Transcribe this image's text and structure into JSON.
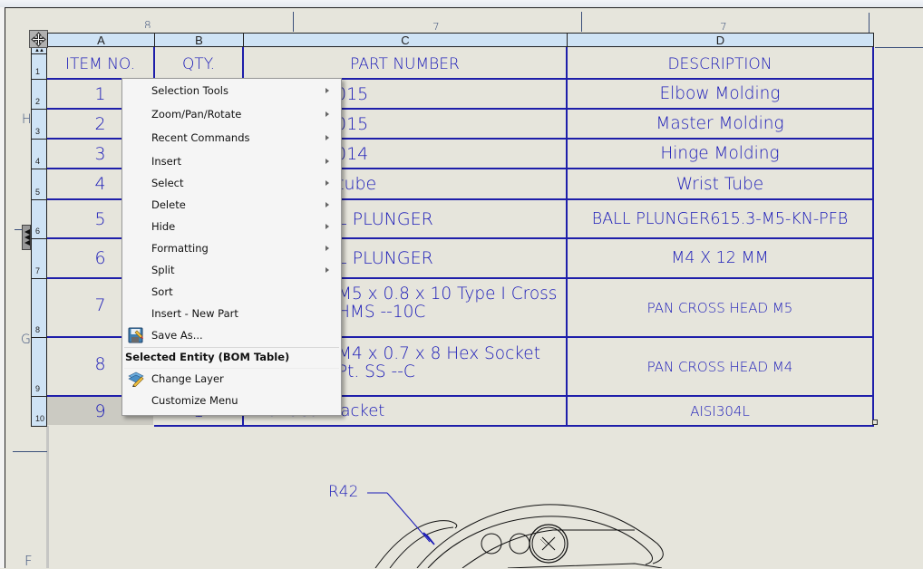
{
  "drawing": {
    "zone_labels": {
      "top": [
        "8",
        "7",
        "7"
      ],
      "left": [
        "H",
        "G",
        "F"
      ]
    },
    "dimension_label": "R42"
  },
  "bom_table": {
    "column_letters": [
      "A",
      "B",
      "C",
      "D"
    ],
    "row_numbers": [
      "1",
      "2",
      "3",
      "4",
      "5",
      "6",
      "7",
      "8",
      "9",
      "10"
    ],
    "headers": {
      "item_no": "ITEM NO.",
      "qty": "QTY.",
      "part_number": "PART NUMBER",
      "description": "DESCRIPTION"
    },
    "rows": [
      {
        "item": "1",
        "qty": "",
        "part": "015",
        "description": "Elbow Molding"
      },
      {
        "item": "2",
        "qty": "",
        "part": "015",
        "description": "Master Molding"
      },
      {
        "item": "3",
        "qty": "",
        "part": "014",
        "description": "Hinge Molding"
      },
      {
        "item": "4",
        "qty": "",
        "part": "tube",
        "description": "Wrist Tube"
      },
      {
        "item": "5",
        "qty": "",
        "part": "L PLUNGER",
        "description": "BALL PLUNGER615.3-M5-KN-PFB"
      },
      {
        "item": "6",
        "qty": "",
        "part": "L PLUNGER",
        "description": "M4 X 12 MM"
      },
      {
        "item": "7",
        "qty": "",
        "part": "M5 x 0.8 x 10 Type I Cross\nHMS --10C",
        "description": "PAN CROSS HEAD M5"
      },
      {
        "item": "8",
        "qty": "",
        "part": "M4 x 0.7 x 8 Hex Socket\nPt. SS --C",
        "description": "PAN CROSS HEAD M4"
      },
      {
        "item": "9",
        "qty": "1",
        "part": "Interface Bracket",
        "description": "AISI304L"
      }
    ],
    "selected_row": "9"
  },
  "context_menu": {
    "items": [
      {
        "label": "Selection Tools",
        "submenu": true
      },
      {
        "label": "Zoom/Pan/Rotate",
        "submenu": true
      },
      {
        "label": "Recent Commands",
        "submenu": true
      },
      {
        "label": "Insert",
        "submenu": true
      },
      {
        "label": "Select",
        "submenu": true
      },
      {
        "label": "Delete",
        "submenu": true
      },
      {
        "label": "Hide",
        "submenu": true
      },
      {
        "label": "Formatting",
        "submenu": true
      },
      {
        "label": "Split",
        "submenu": true
      },
      {
        "label": "Sort",
        "submenu": false
      },
      {
        "label": "Insert - New Part",
        "submenu": false
      },
      {
        "label": "Save As...",
        "submenu": false,
        "icon": "save-as-icon"
      }
    ],
    "section_title": "Selected Entity (BOM Table)",
    "section_items": [
      {
        "label": "Change Layer",
        "icon": "change-layer-icon"
      },
      {
        "label": "Customize Menu"
      }
    ]
  }
}
